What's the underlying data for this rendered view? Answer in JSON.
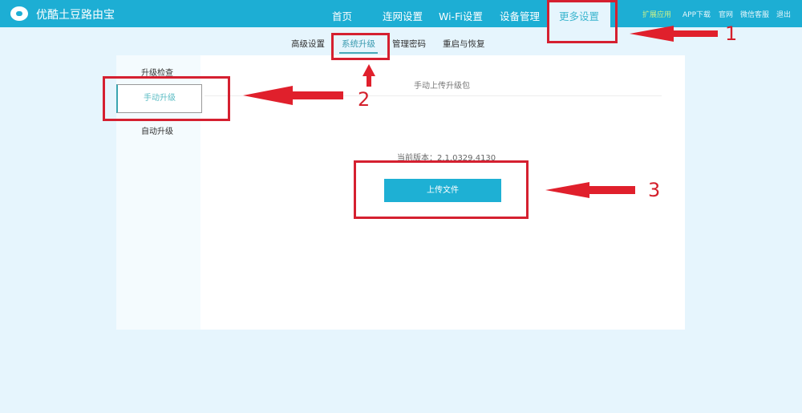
{
  "header": {
    "brand": "优酷土豆路由宝",
    "nav": [
      "首页",
      "连网设置",
      "Wi-Fi设置",
      "设备管理",
      "更多设置"
    ],
    "right_links": [
      "扩展应用",
      "APP下载",
      "官网",
      "微信客服",
      "退出"
    ]
  },
  "subnav": [
    "高级设置",
    "系统升级",
    "管理密码",
    "重启与恢复"
  ],
  "sidebar": [
    "升级检查",
    "手动升级",
    "自动升级"
  ],
  "content": {
    "title": "手动上传升级包",
    "version": "当前版本：2.1.0329.4130",
    "upload_label": "上传文件"
  },
  "annotations": [
    "1",
    "2",
    "3"
  ],
  "colors": {
    "header": "#1daed4",
    "accent": "#3db6cf",
    "annotation": "#d52030"
  }
}
